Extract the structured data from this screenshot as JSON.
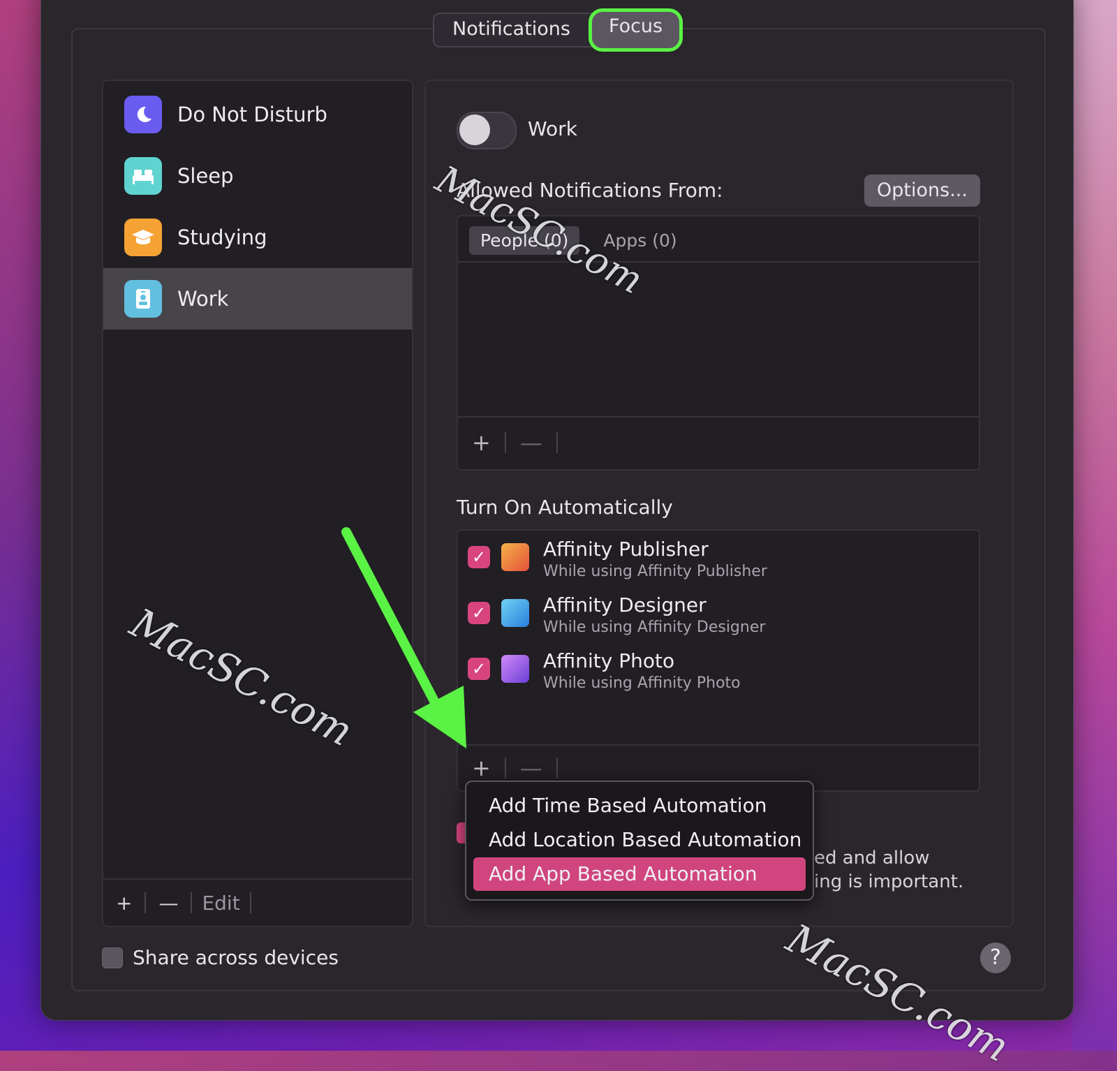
{
  "header": {
    "tabs": [
      {
        "label": "Notifications",
        "selected": false
      },
      {
        "label": "Focus",
        "selected": true
      }
    ]
  },
  "sidebar": {
    "items": [
      {
        "label": "Do Not Disturb",
        "icon": "moon-icon",
        "color": "#6a5cf0",
        "selected": false
      },
      {
        "label": "Sleep",
        "icon": "bed-icon",
        "color": "#5fd3cf",
        "selected": false
      },
      {
        "label": "Studying",
        "icon": "graduation-cap-icon",
        "color": "#f5a234",
        "selected": false
      },
      {
        "label": "Work",
        "icon": "id-badge-icon",
        "color": "#62bfe0",
        "selected": true
      }
    ],
    "toolbar": {
      "add": "+",
      "remove": "—",
      "edit": "Edit"
    }
  },
  "share": {
    "label": "Share across devices",
    "checked": false
  },
  "help": {
    "label": "?"
  },
  "detail": {
    "focus_name": "Work",
    "toggle_on": false,
    "allowed_label": "Allowed Notifications From:",
    "options_label": "Options...",
    "tabs": [
      {
        "label": "People (0)",
        "selected": true
      },
      {
        "label": "Apps (0)",
        "selected": false
      }
    ],
    "people_toolbar": {
      "add": "+",
      "remove": "—"
    },
    "turn_on_label": "Turn On Automatically",
    "automations": [
      {
        "title": "Affinity Publisher",
        "subtitle": "While using Affinity Publisher",
        "checked": true,
        "icon": "affinity-publisher-icon",
        "color": "#f0763a"
      },
      {
        "title": "Affinity Designer",
        "subtitle": "While using Affinity Designer",
        "checked": true,
        "icon": "affinity-designer-icon",
        "color": "#3fa3e8"
      },
      {
        "title": "Affinity Photo",
        "subtitle": "While using Affinity Photo",
        "checked": true,
        "icon": "affinity-photo-icon",
        "color": "#a35fe8"
      }
    ],
    "auto_toolbar": {
      "add": "+",
      "remove": "—"
    },
    "partial_text": [
      "ed and allow",
      "ing is important."
    ]
  },
  "menu": {
    "items": [
      {
        "label": "Add Time Based Automation",
        "highlighted": false
      },
      {
        "label": "Add Location Based Automation",
        "highlighted": false
      },
      {
        "label": "Add App Based Automation",
        "highlighted": true
      }
    ]
  },
  "watermark": {
    "text": "MacSC.com"
  },
  "colors": {
    "accent": "#d0457e",
    "highlight_ring": "#5af244",
    "arrow": "#5af244"
  }
}
